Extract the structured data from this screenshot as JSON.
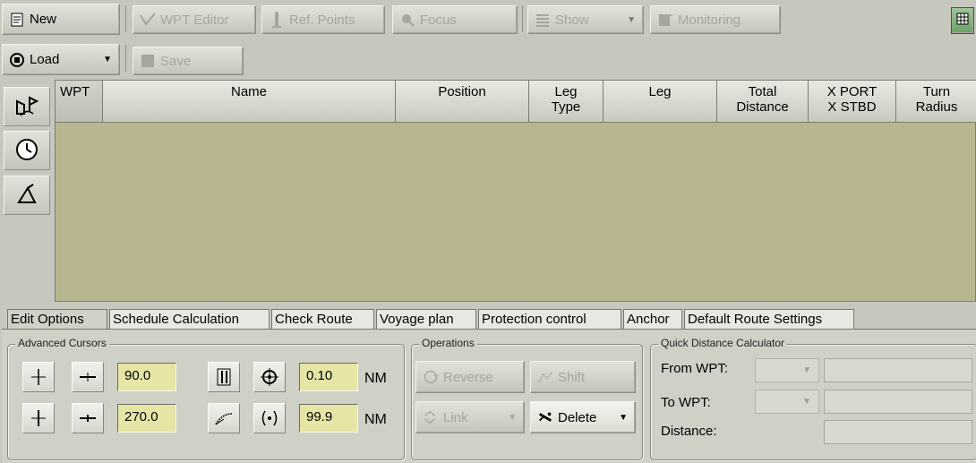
{
  "toolbar": {
    "new_label": "New",
    "wpt_editor_label": "WPT Editor",
    "ref_points_label": "Ref. Points",
    "focus_label": "Focus",
    "show_label": "Show",
    "monitoring_label": "Monitoring",
    "load_label": "Load",
    "save_label": "Save"
  },
  "table": {
    "columns": [
      {
        "line1": "WPT",
        "line2": ""
      },
      {
        "line1": "Name",
        "line2": ""
      },
      {
        "line1": "Position",
        "line2": ""
      },
      {
        "line1": "Leg",
        "line2": "Type"
      },
      {
        "line1": "Leg",
        "line2": ""
      },
      {
        "line1": "Total",
        "line2": "Distance"
      },
      {
        "line1": "X PORT",
        "line2": "X STBD"
      },
      {
        "line1": "Turn",
        "line2": "Radius"
      }
    ],
    "rows": []
  },
  "side_buttons": [
    "route-icon",
    "clock-icon",
    "measure-icon"
  ],
  "tabs": [
    "Edit Options",
    "Schedule Calculation",
    "Check Route",
    "Voyage plan",
    "Protection control",
    "Anchor",
    "Default Route Settings"
  ],
  "active_tab": "Edit Options",
  "advanced_cursors": {
    "title": "Advanced Cursors",
    "angle1": "90.0",
    "angle2": "270.0",
    "dist1": "0.10",
    "dist2": "99.9",
    "unit1": "NM",
    "unit2": "NM"
  },
  "operations": {
    "title": "Operations",
    "reverse_label": "Reverse",
    "shift_label": "Shift",
    "link_label": "Link",
    "delete_label": "Delete"
  },
  "quick_distance": {
    "title": "Quick Distance Calculator",
    "from_label": "From WPT:",
    "to_label": "To WPT:",
    "distance_label": "Distance:"
  },
  "colors": {
    "table_bg": "#b7b691",
    "field_bg": "#e6e5a6",
    "active_green": "#6aa066"
  }
}
